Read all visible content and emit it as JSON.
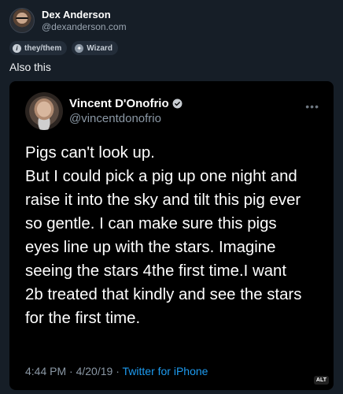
{
  "author": {
    "name": "Dex Anderson",
    "handle": "@dexanderson.com"
  },
  "badges": [
    {
      "label": "they/them",
      "icon": "info-icon"
    },
    {
      "label": "Wizard",
      "icon": "wizard-icon"
    }
  ],
  "post_text": "Also this",
  "embed": {
    "name": "Vincent D'Onofrio",
    "handle": "@vincentdonofrio",
    "more": "•••",
    "body_lines": [
      "Pigs can't look up.",
      "But I could pick a pig up one night and",
      "raise it into the sky and tilt this pig ever",
      "so gentle. I can make sure this pigs",
      "eyes line up with the stars. Imagine",
      "seeing the stars 4the first time.I want",
      "2b treated that kindly and see the stars",
      "for the first time."
    ],
    "time": "4:44 PM",
    "date": "4/20/19",
    "separator": "·",
    "source": "Twitter for iPhone",
    "alt_label": "ALT"
  },
  "colors": {
    "background": "#161e27",
    "embed_background": "#000000",
    "link": "#1d9bf0",
    "verified": "#9aa5b1"
  }
}
